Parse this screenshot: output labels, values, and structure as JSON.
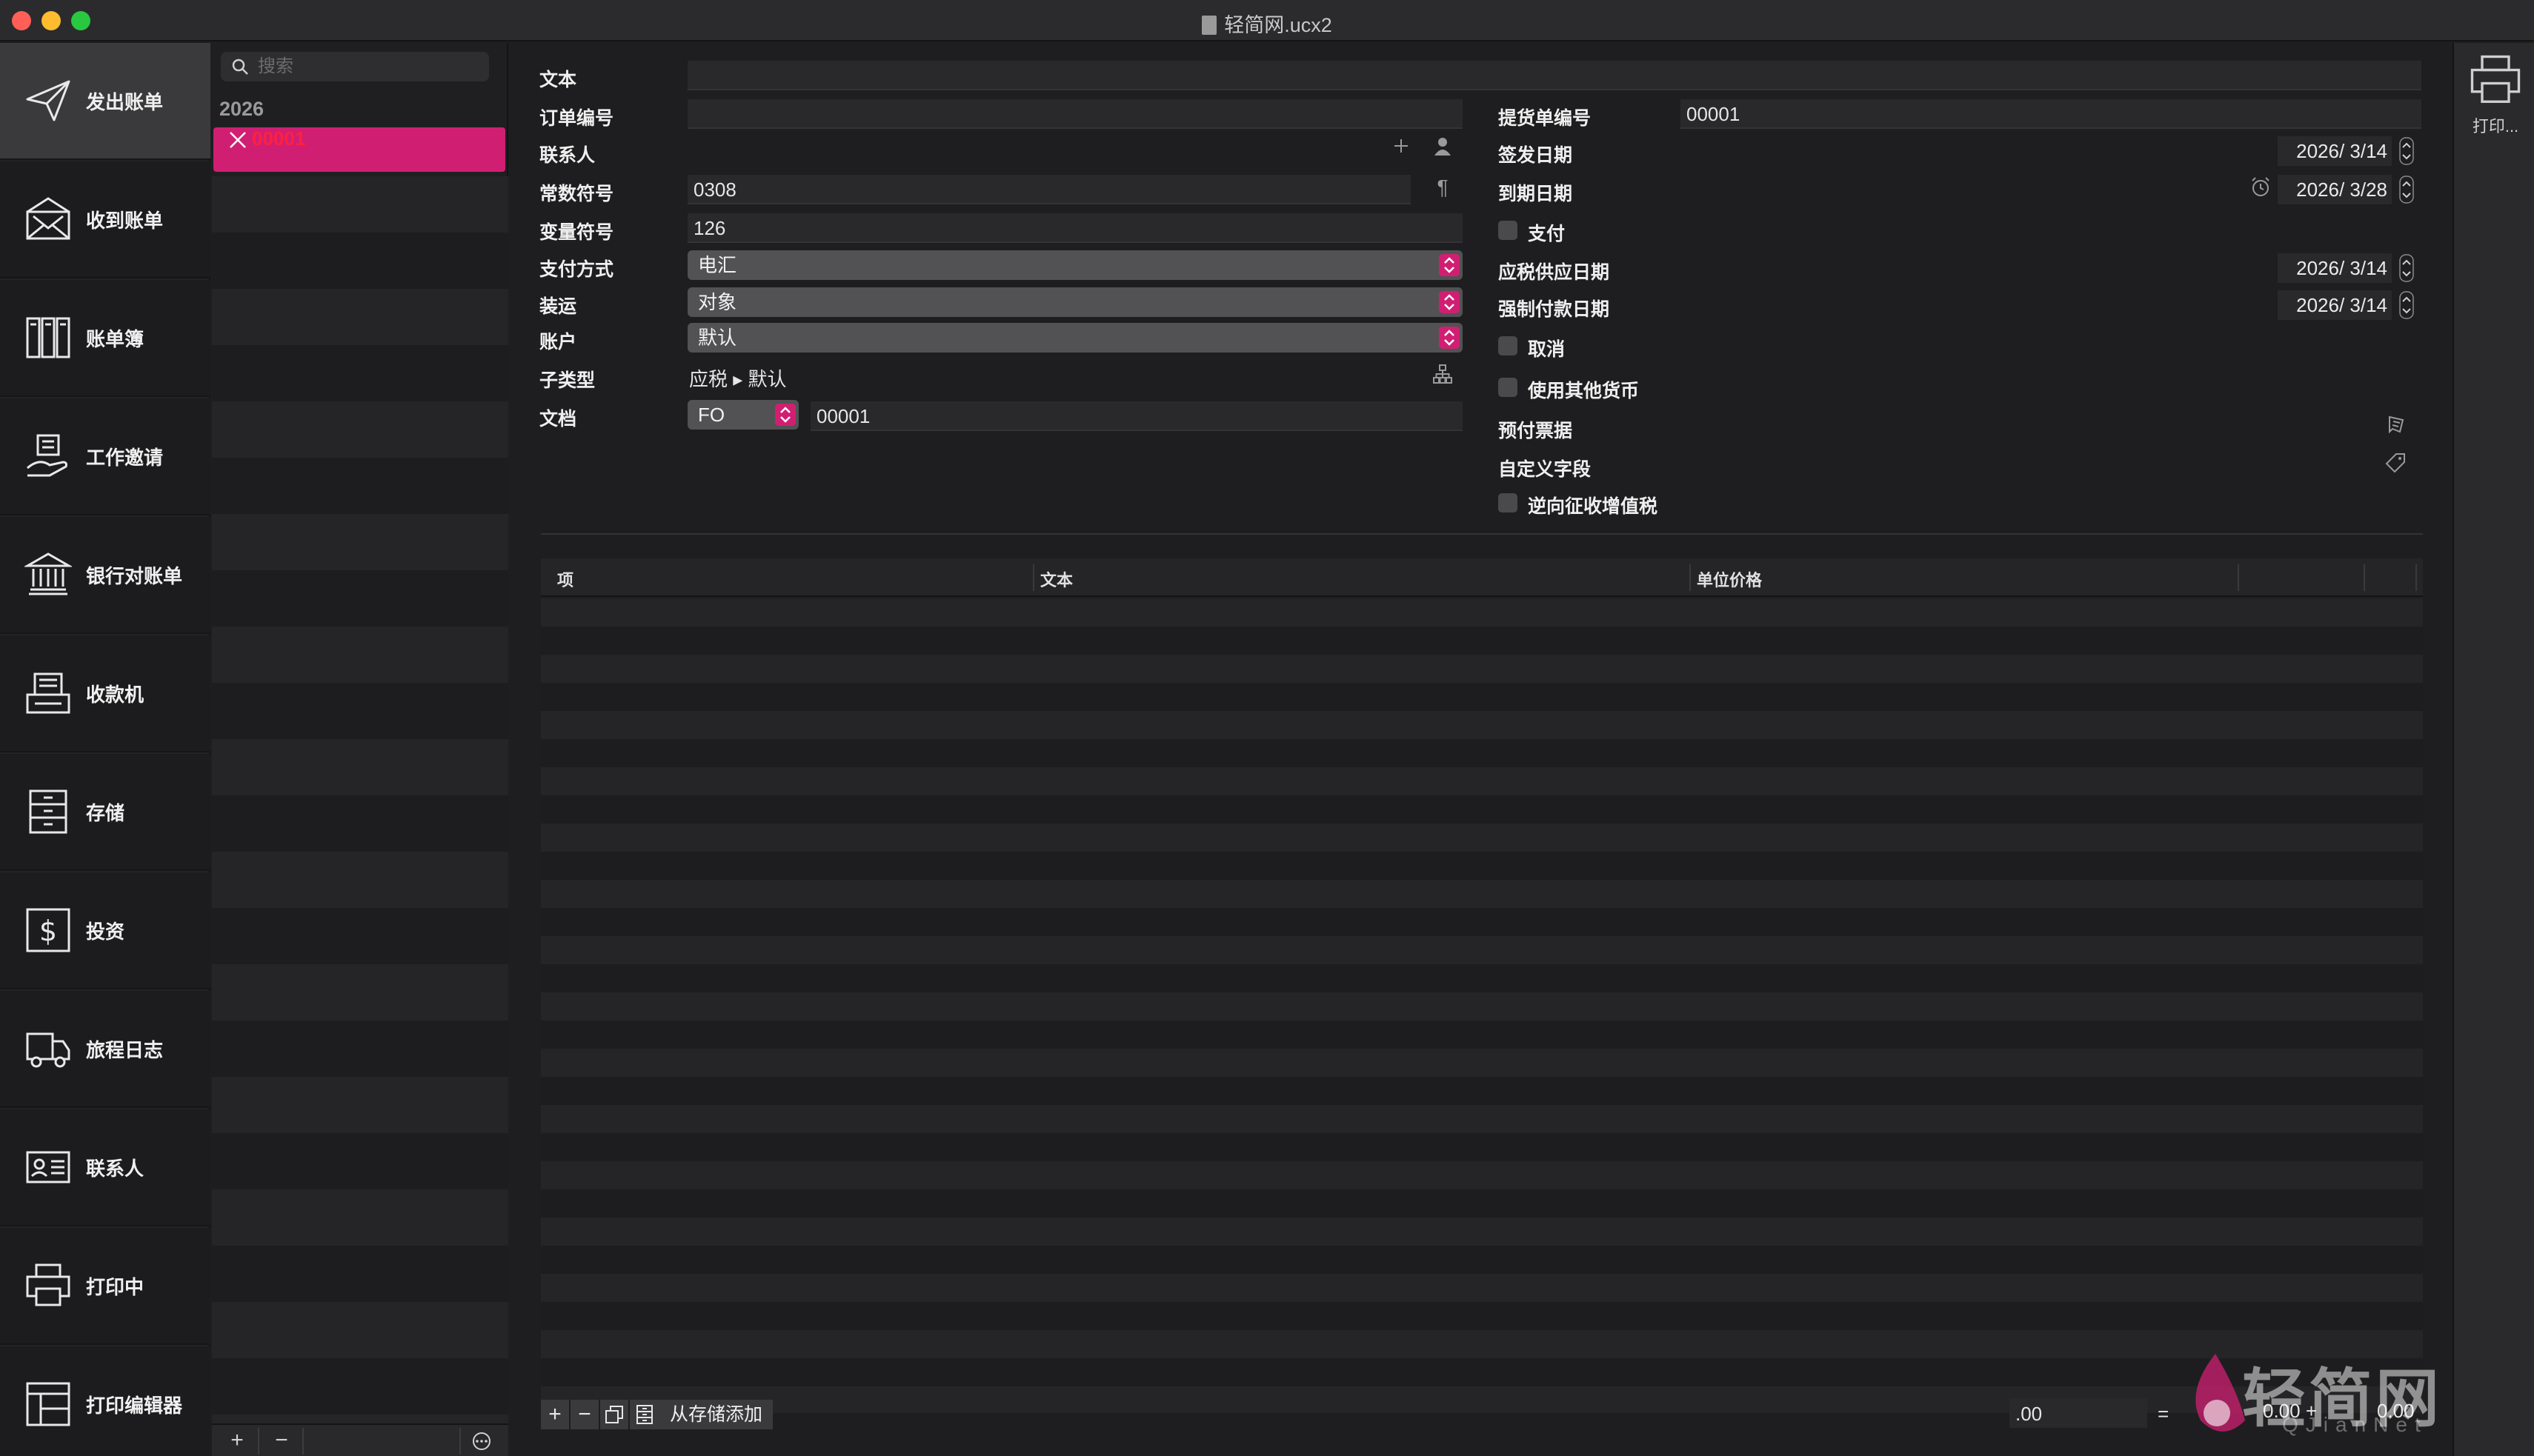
{
  "window": {
    "title": "轻简网.ucx2"
  },
  "sidebar": {
    "items": [
      {
        "label": "发出账单",
        "icon": "paper-plane-icon"
      },
      {
        "label": "收到账单",
        "icon": "envelope-icon"
      },
      {
        "label": "账单簿",
        "icon": "ledger-icon"
      },
      {
        "label": "工作邀请",
        "icon": "job-offer-icon"
      },
      {
        "label": "银行对账单",
        "icon": "bank-icon"
      },
      {
        "label": "收款机",
        "icon": "cash-register-icon"
      },
      {
        "label": "存储",
        "icon": "cabinet-icon"
      },
      {
        "label": "投资",
        "icon": "dollar-icon"
      },
      {
        "label": "旅程日志",
        "icon": "truck-icon"
      },
      {
        "label": "联系人",
        "icon": "contact-card-icon"
      },
      {
        "label": "打印中",
        "icon": "printer-icon"
      },
      {
        "label": "打印编辑器",
        "icon": "layout-icon"
      }
    ]
  },
  "doclist": {
    "search_placeholder": "搜索",
    "year": "2026",
    "selected_doc": "00001",
    "footer": {
      "add": "+",
      "remove": "−",
      "more": "···"
    }
  },
  "form": {
    "text_label": "文本",
    "text_value": "",
    "order_no_label": "订单编号",
    "order_no_value": "",
    "contact_label": "联系人",
    "constant_symbol_label": "常数符号",
    "constant_symbol_value": "0308",
    "variable_symbol_label": "变量符号",
    "variable_symbol_value": "126",
    "payment_method_label": "支付方式",
    "payment_method_value": "电汇",
    "shipping_label": "装运",
    "shipping_value": "对象",
    "account_label": "账户",
    "account_value": "默认",
    "subtype_label": "子类型",
    "subtype_value": "应税 ▸ 默认",
    "document_label": "文档",
    "document_prefix": "FO",
    "document_number": "00001",
    "delivery_no_label": "提货单编号",
    "delivery_no_value": "00001",
    "issue_date_label": "签发日期",
    "issue_date_value": "2026/  3/14",
    "due_date_label": "到期日期",
    "due_date_value": "2026/  3/28",
    "paid_label": "支付",
    "tax_supply_date_label": "应税供应日期",
    "tax_supply_date_value": "2026/  3/14",
    "mandatory_pay_date_label": "强制付款日期",
    "mandatory_pay_date_value": "2026/  3/14",
    "cancel_label": "取消",
    "other_currency_label": "使用其他货币",
    "prepaid_label": "预付票据",
    "custom_fields_label": "自定义字段",
    "reverse_vat_label": "逆向征收增值税"
  },
  "table": {
    "columns": [
      "项",
      "文本",
      "单位价格"
    ],
    "rows": []
  },
  "bottom_toolbar": {
    "add": "+",
    "remove": "−",
    "add_from_storage": "从存储添加"
  },
  "totals": {
    "input_value": ".00",
    "equals": "=",
    "sum_left": "0.00 +",
    "sum_right": "0.00"
  },
  "right_panel": {
    "print_label": "打印..."
  },
  "watermark": {
    "text": "轻简网",
    "sub": "QJianNet"
  },
  "colors": {
    "accent": "#d01f72",
    "selected_text": "#ff2040"
  }
}
